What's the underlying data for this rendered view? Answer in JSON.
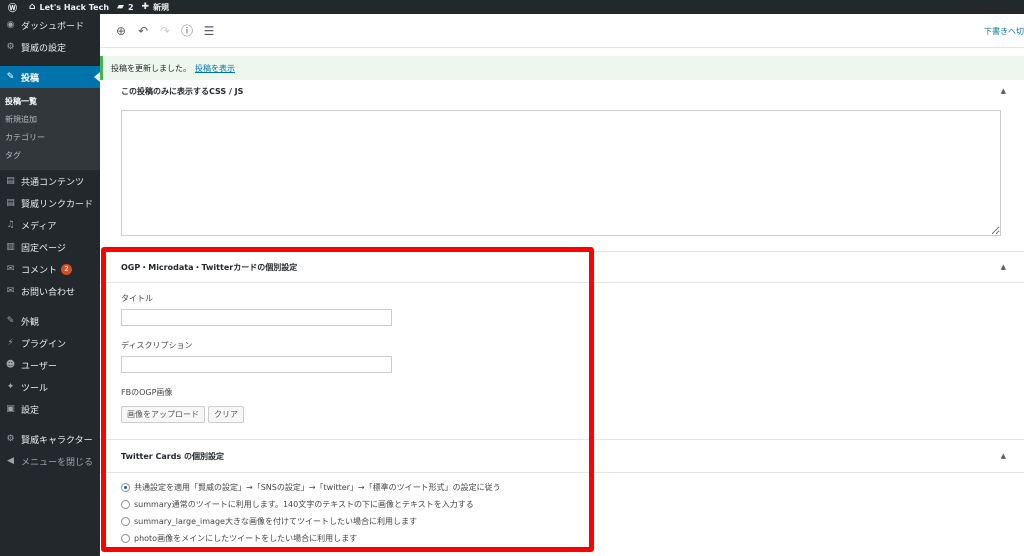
{
  "adminbar": {
    "site_name": "Let's Hack Tech",
    "comments_count": "2",
    "new_label": "新規"
  },
  "sidebar": {
    "items": [
      {
        "label": "ダッシュボード",
        "icon": "dashboard-icon",
        "glyph": "◉"
      },
      {
        "label": "賢威の設定",
        "icon": "gear-icon",
        "glyph": "⚙"
      },
      {
        "label": "投稿",
        "icon": "pin-icon",
        "glyph": "✎"
      },
      {
        "label": "共通コンテンツ",
        "icon": "document-icon",
        "glyph": "▤"
      },
      {
        "label": "賢威リンクカード",
        "icon": "document-icon",
        "glyph": "▤"
      },
      {
        "label": "メディア",
        "icon": "media-icon",
        "glyph": "♫"
      },
      {
        "label": "固定ページ",
        "icon": "page-icon",
        "glyph": "▥"
      },
      {
        "label": "コメント",
        "icon": "comment-icon",
        "glyph": "✉",
        "badge": "2"
      },
      {
        "label": "お問い合わせ",
        "icon": "mail-icon",
        "glyph": "✉"
      },
      {
        "label": "外観",
        "icon": "brush-icon",
        "glyph": "✎"
      },
      {
        "label": "プラグイン",
        "icon": "plugin-icon",
        "glyph": "⚡"
      },
      {
        "label": "ユーザー",
        "icon": "user-icon",
        "glyph": "☻"
      },
      {
        "label": "ツール",
        "icon": "wrench-icon",
        "glyph": "✦"
      },
      {
        "label": "設定",
        "icon": "settings-icon",
        "glyph": "▣"
      },
      {
        "label": "賢威キャラクター",
        "icon": "gear-icon",
        "glyph": "⚙"
      },
      {
        "label": "メニューを閉じる",
        "icon": "collapse-icon",
        "glyph": "◀"
      }
    ],
    "submenu": [
      "投稿一覧",
      "新規追加",
      "カテゴリー",
      "タグ"
    ]
  },
  "toolbar": {
    "draft_label": "下書きへ切"
  },
  "notice": {
    "message": "投稿を更新しました。",
    "link": "投稿を表示"
  },
  "panels": {
    "css_js": {
      "title": "この投稿のみに表示するCSS / JS"
    },
    "ogp": {
      "title": "OGP・Microdata・Twitterカードの個別設定",
      "title_label": "タイトル",
      "description_label": "ディスクリプション",
      "image_label": "FBのOGP画像",
      "upload_button": "画像をアップロード",
      "clear_button": "クリア"
    },
    "twitter": {
      "title": "Twitter Cards の個別設定",
      "options": [
        "共通設定を適用「賢威の設定」→「SNSの設定」→「twitter」→「標準のツイート形式」の設定に従う",
        "summary通常のツイートに利用します。140文字のテキストの下に画像とテキストを入力する",
        "summary_large_image大きな画像を付けてツイートしたい場合に利用します",
        "photo画像をメインにしたツイートをしたい場合に利用します"
      ],
      "selected_index": 0
    }
  },
  "colors": {
    "highlight": "#ff0000",
    "active_menu": "#0073aa",
    "adminbar": "#23282d"
  }
}
